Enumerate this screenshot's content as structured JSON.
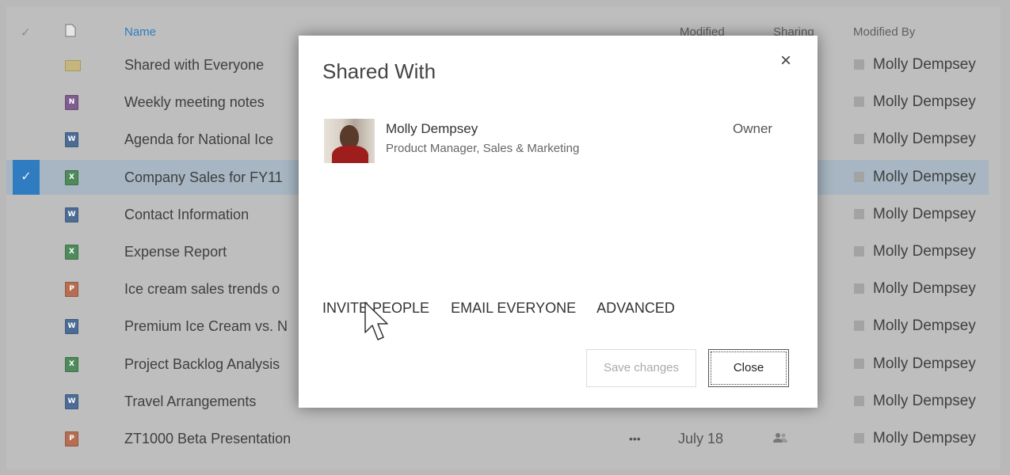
{
  "columns": {
    "name": "Name",
    "modified": "Modified",
    "sharing": "Sharing",
    "modified_by": "Modified By"
  },
  "files": [
    {
      "name": "Shared with Everyone",
      "type": "folder",
      "modified_by": "Molly Dempsey"
    },
    {
      "name": "Weekly meeting notes",
      "type": "onenote",
      "modified_by": "Molly Dempsey"
    },
    {
      "name": "Agenda for National Ice",
      "type": "word",
      "modified_by": "Molly Dempsey"
    },
    {
      "name": "Company Sales for FY11",
      "type": "excel",
      "modified_by": "Molly Dempsey",
      "selected": true
    },
    {
      "name": "Contact Information",
      "type": "word",
      "modified_by": "Molly Dempsey"
    },
    {
      "name": "Expense Report",
      "type": "excel",
      "modified_by": "Molly Dempsey"
    },
    {
      "name": "Ice cream sales trends o",
      "type": "powerpoint",
      "modified_by": "Molly Dempsey"
    },
    {
      "name": "Premium Ice Cream vs. N",
      "type": "word",
      "modified_by": "Molly Dempsey"
    },
    {
      "name": "Project Backlog Analysis",
      "type": "excel",
      "modified_by": "Molly Dempsey"
    },
    {
      "name": "Travel Arrangements",
      "type": "word",
      "modified_by": "Molly Dempsey"
    },
    {
      "name": "ZT1000 Beta Presentation",
      "type": "powerpoint",
      "modified_by": "Molly Dempsey",
      "more": "•••",
      "modified": "July 18",
      "sharing_icon": "people-icon"
    }
  ],
  "dialog": {
    "title": "Shared With",
    "close_icon": "×",
    "person": {
      "name": "Molly Dempsey",
      "title": "Product Manager, Sales & Marketing",
      "role": "Owner"
    },
    "actions": [
      "INVITE PEOPLE",
      "EMAIL EVERYONE",
      "ADVANCED"
    ],
    "save_label": "Save changes",
    "close_label": "Close"
  },
  "colors": {
    "selected_row": "#a7b6c2",
    "check_accent": "#2f7cc0"
  }
}
